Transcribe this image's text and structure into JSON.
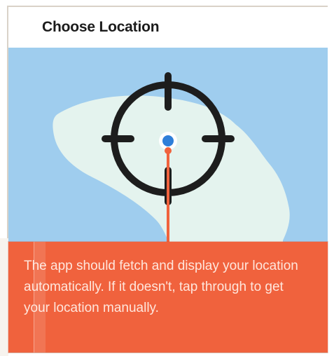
{
  "header": {
    "title": "Choose Location"
  },
  "map": {
    "water_color": "#9fcdee",
    "land_color": "#e4f3ee",
    "crosshair_icon": "crosshair-target-icon",
    "pin_color": "#2f7fd9",
    "pin_line_color": "#f0623d"
  },
  "callout": {
    "text": "The app should fetch and display your location automatically. If it doesn't, tap through to get your location manually.",
    "background": "#f0623d"
  }
}
